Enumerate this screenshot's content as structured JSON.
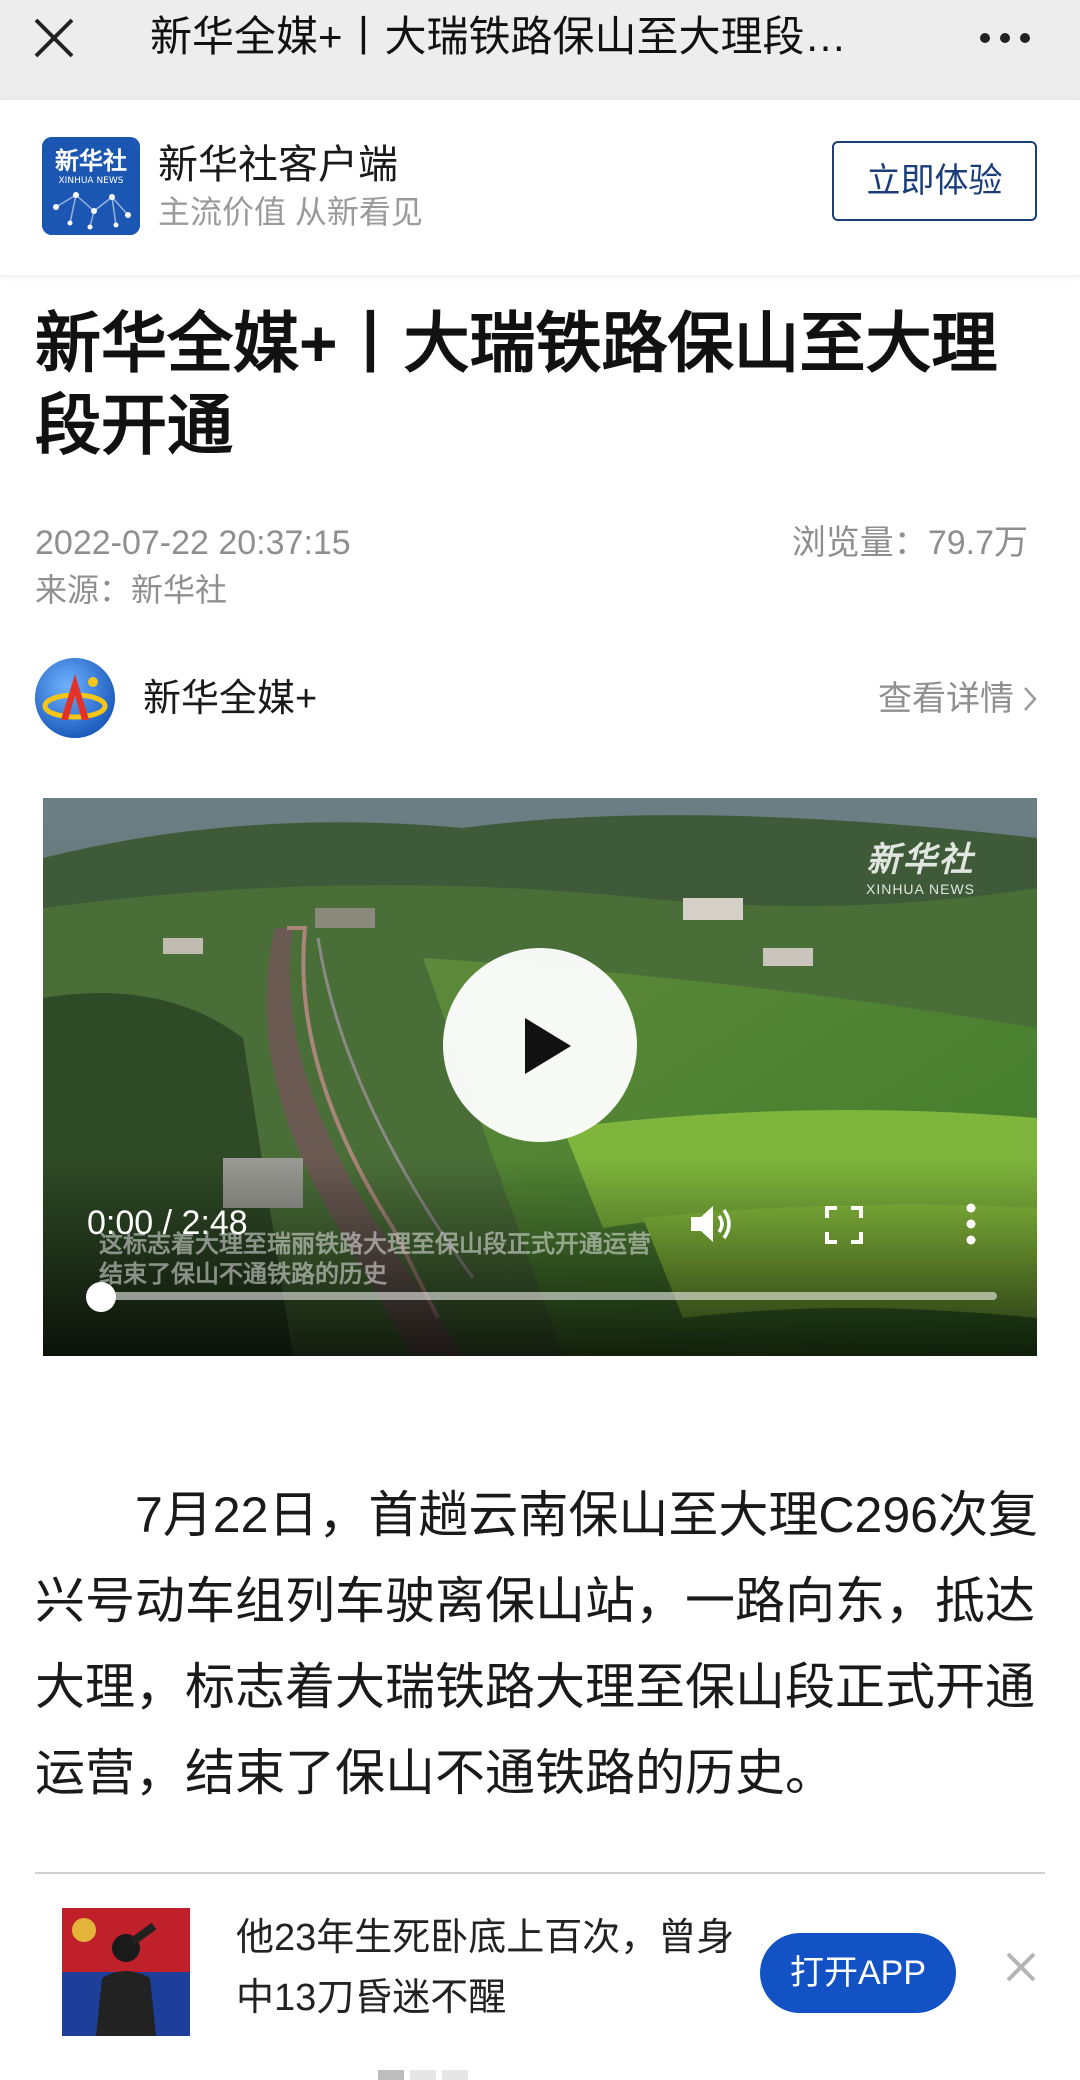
{
  "topbar": {
    "title": "新华全媒+丨大瑞铁路保山至大理段…",
    "close_icon": "close-icon",
    "more_icon": "more-horizontal-icon"
  },
  "promo": {
    "app_name": "新华社客户端",
    "slogan": "主流价值 从新看见",
    "cta": "立即体验",
    "logo_text_cn": "新华社",
    "logo_text_en": "XINHUA NEWS"
  },
  "article": {
    "title": "新华全媒+丨大瑞铁路保山至大理段开通",
    "datetime": "2022-07-22 20:37:15",
    "views_label": "浏览量：",
    "views_value": "79.7万",
    "source_label": "来源：",
    "source_value": "新华社",
    "paragraph": "7月22日，首趟云南保山至大理C296次复兴号动车组列车驶离保山站，一路向东，抵达大理，标志着大瑞铁路大理至保山段正式开通运营，结束了保山不通铁路的历史。"
  },
  "channel": {
    "name": "新华全媒+",
    "more_label": "查看详情"
  },
  "video": {
    "watermark_cn": "新华社",
    "watermark_en": "XINHUA NEWS",
    "caption_line1": "这标志着大理至瑞丽铁路大理至保山段正式开通运营",
    "caption_line2": "结束了保山不通铁路的历史",
    "current_time": "0:00",
    "separator": " / ",
    "duration": "2:48",
    "progress_fraction": 0.0
  },
  "recommendation": {
    "text": "他23年生死卧底上百次，曾身中13刀昏迷不醒",
    "open_app": "打开APP"
  },
  "colors": {
    "topbar_bg": "#ededed",
    "brand_blue": "#1352c4",
    "cta_border": "#1b3e7a",
    "meta_gray": "#8f8f8f"
  }
}
